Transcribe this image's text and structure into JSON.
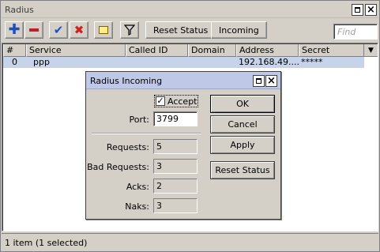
{
  "window": {
    "title": "Radius"
  },
  "toolbar": {
    "reset_status_label": "Reset Status",
    "incoming_label": "Incoming",
    "find_placeholder": "Find",
    "icons": [
      "add-icon",
      "remove-icon",
      "enable-check-icon",
      "disable-x-icon",
      "comment-icon",
      "filter-icon"
    ]
  },
  "table": {
    "columns": [
      "#",
      "Service",
      "Called ID",
      "Domain",
      "Address",
      "Secret"
    ],
    "rows": [
      {
        "num": "0",
        "service": "ppp",
        "called_id": "",
        "domain": "",
        "address": "192.168.49....",
        "secret": "*****"
      }
    ]
  },
  "status": {
    "text": "1 item (1 selected)"
  },
  "dialog": {
    "title": "Radius Incoming",
    "accept_label": "Accept",
    "accept_checked": true,
    "port_label": "Port:",
    "port_value": "3799",
    "requests_label": "Requests:",
    "requests_value": "5",
    "bad_requests_label": "Bad Requests:",
    "bad_requests_value": "3",
    "acks_label": "Acks:",
    "acks_value": "2",
    "naks_label": "Naks:",
    "naks_value": "3",
    "buttons": {
      "ok": "OK",
      "cancel": "Cancel",
      "apply": "Apply",
      "reset_status": "Reset Status"
    }
  },
  "colors": {
    "selected_row": "#c6d3e8",
    "dialog_title": "#bfc8e6",
    "add": "#1f4fbf",
    "remove": "#c0202a",
    "check": "#2050c0",
    "xmark": "#d02020"
  }
}
